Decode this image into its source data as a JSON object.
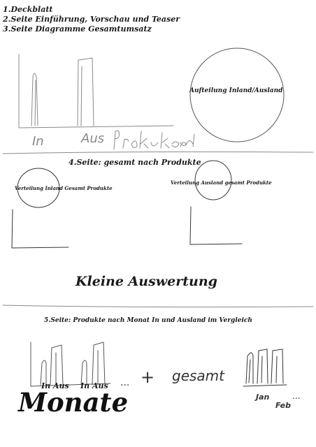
{
  "outline": {
    "line1": "1.Deckblatt",
    "line2": "2.Seite Einführung, Vorschau und Teaser",
    "line3": "3.Seite Diagramme Gesamtumsatz"
  },
  "page3_sketch": {
    "circle_label": "Aufteilung Inland/Ausland",
    "handwritten_labels": {
      "in": "In",
      "aus": "Aus",
      "produkte_gesamt": "Produkte gesamt"
    }
  },
  "page4": {
    "heading": "4.Seite: gesamt nach Produkte",
    "left_circle_label": "Verteilung Inland Gesamt Produkte",
    "right_circle_label": "Verteilung Ausland gesamt Produkte",
    "summary_title": "Kleine Auswertung"
  },
  "page5": {
    "heading": "5.Seite: Produkte nach Monat In und Ausland im Vergleich",
    "bar_label_1": "In Aus",
    "bar_label_2": "In Aus",
    "ellipsis": "...",
    "plus": "+",
    "handwritten_gesamt": "gesamt",
    "month_label": "Monate",
    "handwritten_months": {
      "jan": "Jan",
      "feb": "Feb",
      "more": "..."
    }
  },
  "colors": {
    "ink": "#1a1a1a",
    "pencil": "#555555",
    "divider": "#8a8a8a"
  }
}
